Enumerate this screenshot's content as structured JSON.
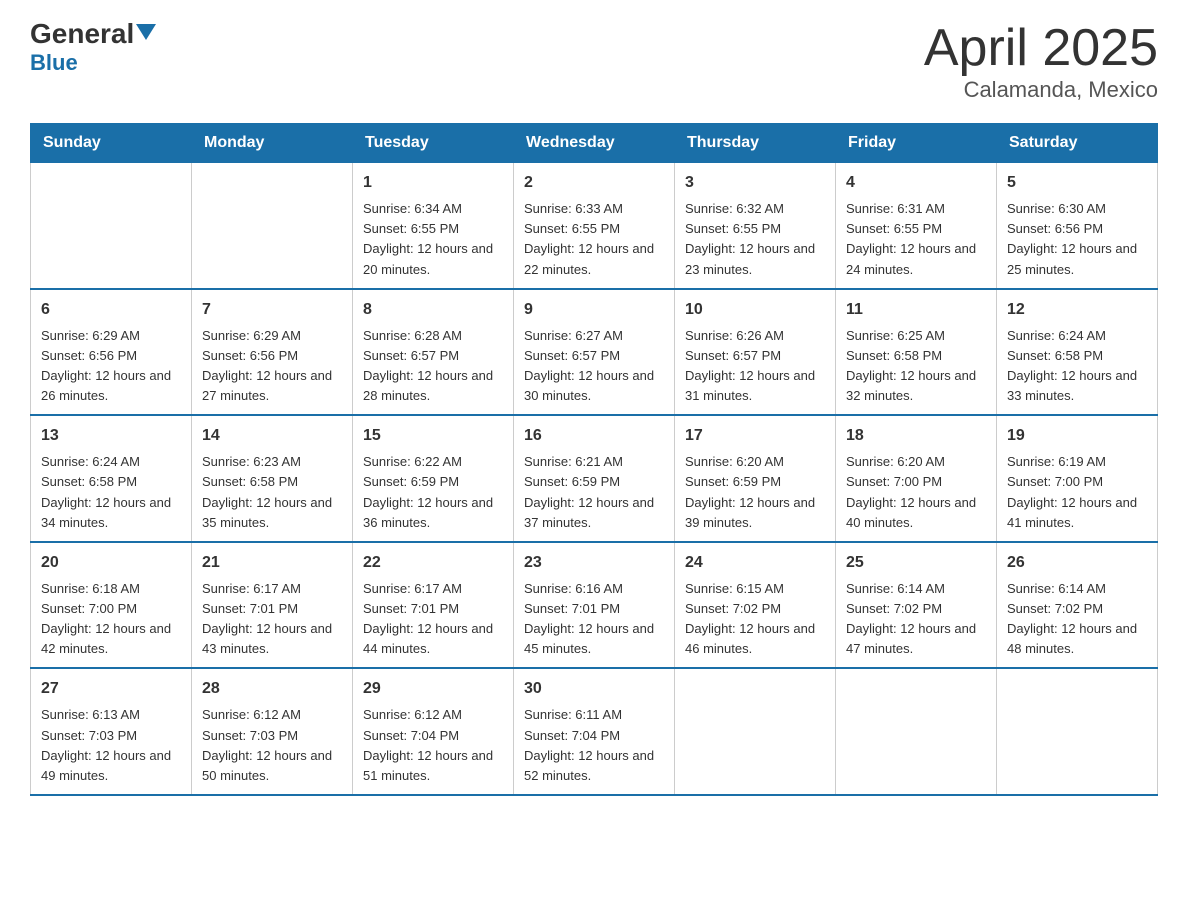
{
  "header": {
    "logo_general": "General",
    "logo_blue": "Blue",
    "month_title": "April 2025",
    "location": "Calamanda, Mexico"
  },
  "days_of_week": [
    "Sunday",
    "Monday",
    "Tuesday",
    "Wednesday",
    "Thursday",
    "Friday",
    "Saturday"
  ],
  "weeks": [
    [
      {
        "day": "",
        "sunrise": "",
        "sunset": "",
        "daylight": ""
      },
      {
        "day": "",
        "sunrise": "",
        "sunset": "",
        "daylight": ""
      },
      {
        "day": "1",
        "sunrise": "Sunrise: 6:34 AM",
        "sunset": "Sunset: 6:55 PM",
        "daylight": "Daylight: 12 hours and 20 minutes."
      },
      {
        "day": "2",
        "sunrise": "Sunrise: 6:33 AM",
        "sunset": "Sunset: 6:55 PM",
        "daylight": "Daylight: 12 hours and 22 minutes."
      },
      {
        "day": "3",
        "sunrise": "Sunrise: 6:32 AM",
        "sunset": "Sunset: 6:55 PM",
        "daylight": "Daylight: 12 hours and 23 minutes."
      },
      {
        "day": "4",
        "sunrise": "Sunrise: 6:31 AM",
        "sunset": "Sunset: 6:55 PM",
        "daylight": "Daylight: 12 hours and 24 minutes."
      },
      {
        "day": "5",
        "sunrise": "Sunrise: 6:30 AM",
        "sunset": "Sunset: 6:56 PM",
        "daylight": "Daylight: 12 hours and 25 minutes."
      }
    ],
    [
      {
        "day": "6",
        "sunrise": "Sunrise: 6:29 AM",
        "sunset": "Sunset: 6:56 PM",
        "daylight": "Daylight: 12 hours and 26 minutes."
      },
      {
        "day": "7",
        "sunrise": "Sunrise: 6:29 AM",
        "sunset": "Sunset: 6:56 PM",
        "daylight": "Daylight: 12 hours and 27 minutes."
      },
      {
        "day": "8",
        "sunrise": "Sunrise: 6:28 AM",
        "sunset": "Sunset: 6:57 PM",
        "daylight": "Daylight: 12 hours and 28 minutes."
      },
      {
        "day": "9",
        "sunrise": "Sunrise: 6:27 AM",
        "sunset": "Sunset: 6:57 PM",
        "daylight": "Daylight: 12 hours and 30 minutes."
      },
      {
        "day": "10",
        "sunrise": "Sunrise: 6:26 AM",
        "sunset": "Sunset: 6:57 PM",
        "daylight": "Daylight: 12 hours and 31 minutes."
      },
      {
        "day": "11",
        "sunrise": "Sunrise: 6:25 AM",
        "sunset": "Sunset: 6:58 PM",
        "daylight": "Daylight: 12 hours and 32 minutes."
      },
      {
        "day": "12",
        "sunrise": "Sunrise: 6:24 AM",
        "sunset": "Sunset: 6:58 PM",
        "daylight": "Daylight: 12 hours and 33 minutes."
      }
    ],
    [
      {
        "day": "13",
        "sunrise": "Sunrise: 6:24 AM",
        "sunset": "Sunset: 6:58 PM",
        "daylight": "Daylight: 12 hours and 34 minutes."
      },
      {
        "day": "14",
        "sunrise": "Sunrise: 6:23 AM",
        "sunset": "Sunset: 6:58 PM",
        "daylight": "Daylight: 12 hours and 35 minutes."
      },
      {
        "day": "15",
        "sunrise": "Sunrise: 6:22 AM",
        "sunset": "Sunset: 6:59 PM",
        "daylight": "Daylight: 12 hours and 36 minutes."
      },
      {
        "day": "16",
        "sunrise": "Sunrise: 6:21 AM",
        "sunset": "Sunset: 6:59 PM",
        "daylight": "Daylight: 12 hours and 37 minutes."
      },
      {
        "day": "17",
        "sunrise": "Sunrise: 6:20 AM",
        "sunset": "Sunset: 6:59 PM",
        "daylight": "Daylight: 12 hours and 39 minutes."
      },
      {
        "day": "18",
        "sunrise": "Sunrise: 6:20 AM",
        "sunset": "Sunset: 7:00 PM",
        "daylight": "Daylight: 12 hours and 40 minutes."
      },
      {
        "day": "19",
        "sunrise": "Sunrise: 6:19 AM",
        "sunset": "Sunset: 7:00 PM",
        "daylight": "Daylight: 12 hours and 41 minutes."
      }
    ],
    [
      {
        "day": "20",
        "sunrise": "Sunrise: 6:18 AM",
        "sunset": "Sunset: 7:00 PM",
        "daylight": "Daylight: 12 hours and 42 minutes."
      },
      {
        "day": "21",
        "sunrise": "Sunrise: 6:17 AM",
        "sunset": "Sunset: 7:01 PM",
        "daylight": "Daylight: 12 hours and 43 minutes."
      },
      {
        "day": "22",
        "sunrise": "Sunrise: 6:17 AM",
        "sunset": "Sunset: 7:01 PM",
        "daylight": "Daylight: 12 hours and 44 minutes."
      },
      {
        "day": "23",
        "sunrise": "Sunrise: 6:16 AM",
        "sunset": "Sunset: 7:01 PM",
        "daylight": "Daylight: 12 hours and 45 minutes."
      },
      {
        "day": "24",
        "sunrise": "Sunrise: 6:15 AM",
        "sunset": "Sunset: 7:02 PM",
        "daylight": "Daylight: 12 hours and 46 minutes."
      },
      {
        "day": "25",
        "sunrise": "Sunrise: 6:14 AM",
        "sunset": "Sunset: 7:02 PM",
        "daylight": "Daylight: 12 hours and 47 minutes."
      },
      {
        "day": "26",
        "sunrise": "Sunrise: 6:14 AM",
        "sunset": "Sunset: 7:02 PM",
        "daylight": "Daylight: 12 hours and 48 minutes."
      }
    ],
    [
      {
        "day": "27",
        "sunrise": "Sunrise: 6:13 AM",
        "sunset": "Sunset: 7:03 PM",
        "daylight": "Daylight: 12 hours and 49 minutes."
      },
      {
        "day": "28",
        "sunrise": "Sunrise: 6:12 AM",
        "sunset": "Sunset: 7:03 PM",
        "daylight": "Daylight: 12 hours and 50 minutes."
      },
      {
        "day": "29",
        "sunrise": "Sunrise: 6:12 AM",
        "sunset": "Sunset: 7:04 PM",
        "daylight": "Daylight: 12 hours and 51 minutes."
      },
      {
        "day": "30",
        "sunrise": "Sunrise: 6:11 AM",
        "sunset": "Sunset: 7:04 PM",
        "daylight": "Daylight: 12 hours and 52 minutes."
      },
      {
        "day": "",
        "sunrise": "",
        "sunset": "",
        "daylight": ""
      },
      {
        "day": "",
        "sunrise": "",
        "sunset": "",
        "daylight": ""
      },
      {
        "day": "",
        "sunrise": "",
        "sunset": "",
        "daylight": ""
      }
    ]
  ]
}
